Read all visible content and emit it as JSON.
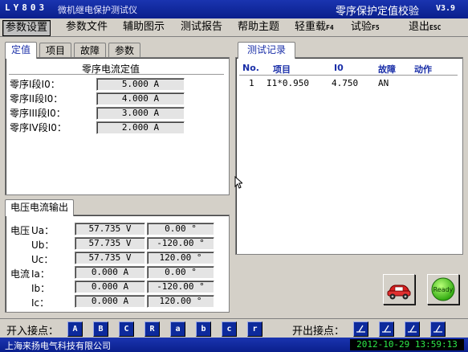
{
  "titlebar": {
    "model": "LY803",
    "app_title": "微机继电保护测试仪",
    "module": "零序保护定值校验",
    "version": "V3.9"
  },
  "menu": [
    {
      "label": "参数设置",
      "key": ""
    },
    {
      "label": "参数文件",
      "key": ""
    },
    {
      "label": "辅助图示",
      "key": ""
    },
    {
      "label": "测试报告",
      "key": ""
    },
    {
      "label": "帮助主题",
      "key": ""
    },
    {
      "label": "轻重载",
      "key": "F4"
    },
    {
      "label": "试验",
      "key": "F5"
    },
    {
      "label": "退出",
      "key": "ESC"
    }
  ],
  "left_tabs": [
    "定值",
    "项目",
    "故障",
    "参数"
  ],
  "setting": {
    "title": "零序电流定值",
    "rows": [
      {
        "label": "零序I段I0：",
        "value": "5.000 A"
      },
      {
        "label": "零序II段I0：",
        "value": "4.000 A"
      },
      {
        "label": "零序III段I0：",
        "value": "3.000 A"
      },
      {
        "label": "零序IV段I0：",
        "value": "2.000 A"
      }
    ]
  },
  "output": {
    "tab": "电压电流输出",
    "rows": [
      {
        "group": "电压",
        "phase": "Ua：",
        "mag": "57.735 V",
        "angle": "0.00 °"
      },
      {
        "group": "",
        "phase": "Ub：",
        "mag": "57.735 V",
        "angle": "-120.00 °"
      },
      {
        "group": "",
        "phase": "Uc：",
        "mag": "57.735 V",
        "angle": "120.00 °"
      },
      {
        "group": "电流",
        "phase": "Ia：",
        "mag": "0.000 A",
        "angle": "0.00 °"
      },
      {
        "group": "",
        "phase": "Ib：",
        "mag": "0.000 A",
        "angle": "-120.00 °"
      },
      {
        "group": "",
        "phase": "Ic：",
        "mag": "0.000 A",
        "angle": "120.00 °"
      }
    ]
  },
  "record": {
    "tab": "测试记录",
    "headers": [
      "No.",
      "项目",
      "I0",
      "故障",
      "动作"
    ],
    "rows": [
      [
        "1",
        "I1*0.950",
        "4.750",
        "AN",
        ""
      ]
    ]
  },
  "buttons": {
    "ready_label": "Ready"
  },
  "switches": {
    "input_label": "开入接点：",
    "inputs": [
      "A",
      "B",
      "C",
      "R",
      "a",
      "b",
      "c",
      "r"
    ],
    "output_label": "开出接点：",
    "output_count": 4
  },
  "status": {
    "company": "上海来扬电气科技有限公司",
    "datetime": "2012-10-29 13:59:13"
  },
  "colors": {
    "titlebar": "#0a1f8c",
    "tab_active_text": "#1a2fa8",
    "clock_text": "#2ee84a",
    "switch_button": "#0d2a9c"
  }
}
